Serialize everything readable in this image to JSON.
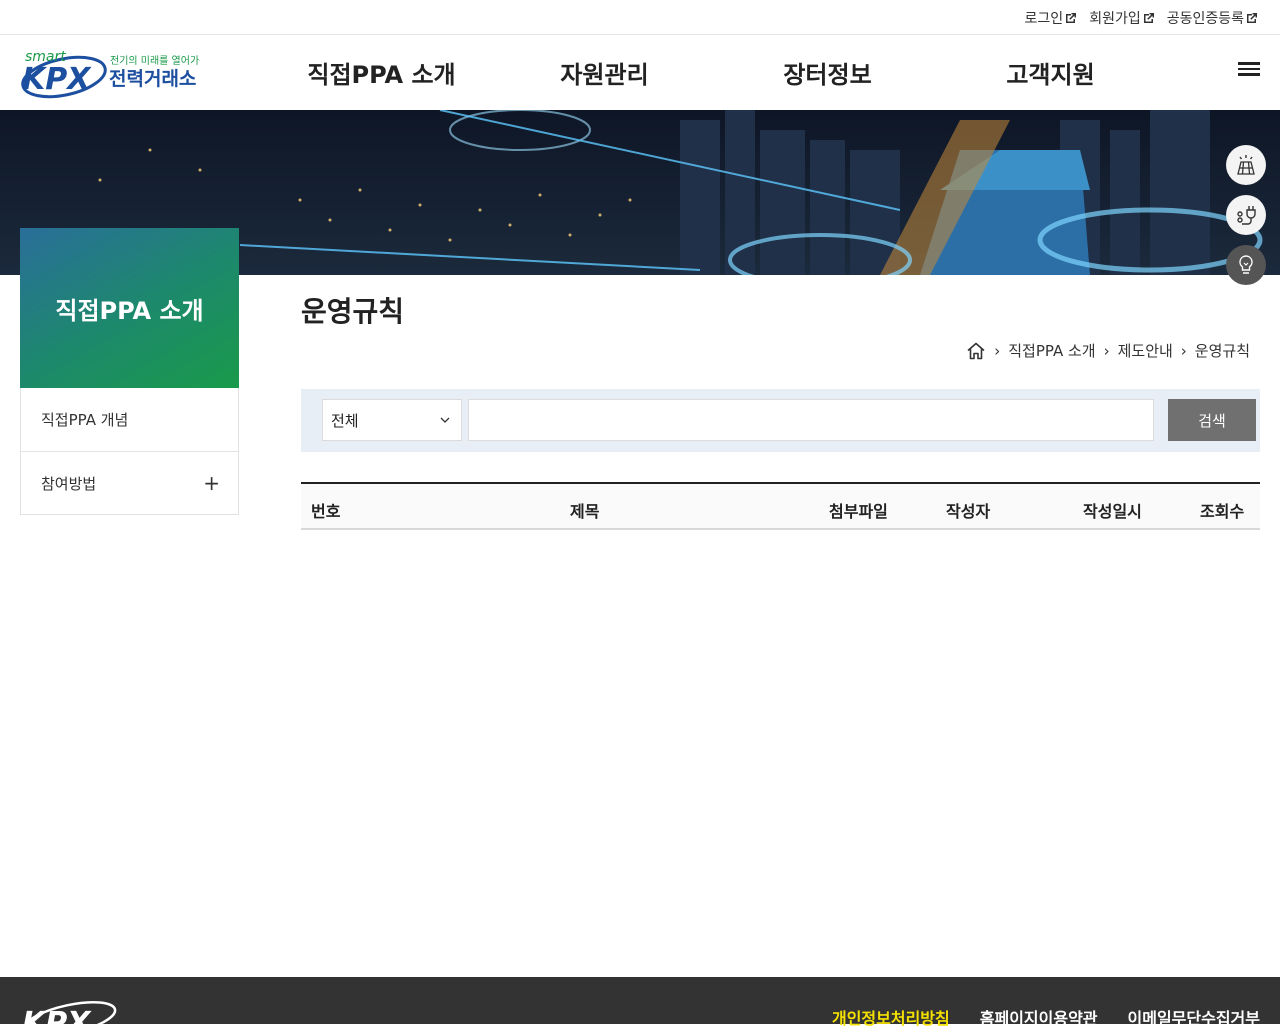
{
  "util": {
    "login": "로그인",
    "signup": "회원가입",
    "cert": "공동인증등록"
  },
  "logo": {
    "smart": "smart",
    "kpx": "KPX",
    "slogan": "전기의 미래를 열어가는",
    "name": "전력거래소"
  },
  "gnb": [
    "직접PPA 소개",
    "자원관리",
    "장터정보",
    "고객지원"
  ],
  "lnb": {
    "title": "직접PPA 소개",
    "items": [
      {
        "label": "직접PPA 개념"
      },
      {
        "label": "참여방법"
      }
    ]
  },
  "page": {
    "title": "운영규칙",
    "breadcrumb": [
      "직접PPA 소개",
      "제도안내",
      "운영규칙"
    ]
  },
  "search": {
    "select_value": "전체",
    "input_value": "",
    "button": "검색"
  },
  "table": {
    "headers": [
      "번호",
      "제목",
      "첨부파일",
      "작성자",
      "작성일시",
      "조회수"
    ]
  },
  "footer": {
    "logo": "KPX",
    "links": [
      "개인정보처리방침",
      "홈페이지이용약관",
      "이메일무단수집거부"
    ]
  },
  "colors": {
    "lnb_gradient_start": "#2a6e9a",
    "lnb_gradient_end": "#1a9a4a",
    "footer_bg": "#333333",
    "footer_highlight": "#f5e100",
    "search_bg": "#e8eef6",
    "search_button": "#707070"
  }
}
